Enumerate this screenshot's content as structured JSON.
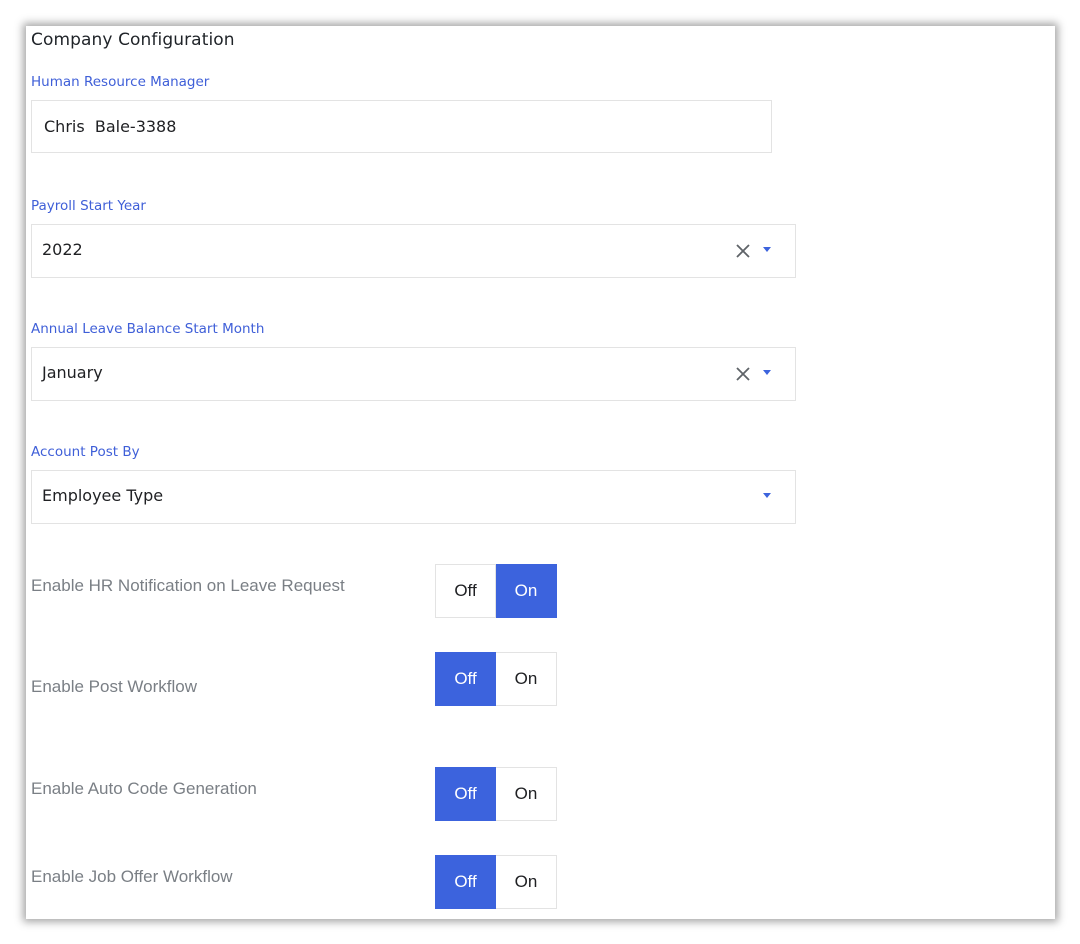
{
  "page": {
    "title": "Company Configuration"
  },
  "fields": {
    "hr_manager": {
      "label": "Human Resource Manager",
      "value": "Chris  Bale-3388"
    },
    "payroll_start_year": {
      "label": "Payroll Start Year",
      "value": "2022"
    },
    "leave_start_month": {
      "label": "Annual Leave Balance Start Month",
      "value": "January"
    },
    "account_post_by": {
      "label": "Account Post By",
      "value": "Employee Type"
    }
  },
  "toggles": [
    {
      "label": "Enable HR Notification on Leave Request",
      "off": "Off",
      "on": "On",
      "selected": "On"
    },
    {
      "label": "Enable Post Workflow",
      "off": "Off",
      "on": "On",
      "selected": "Off"
    },
    {
      "label": "Enable Auto Code Generation",
      "off": "Off",
      "on": "On",
      "selected": "Off"
    },
    {
      "label": "Enable Job Offer Workflow",
      "off": "Off",
      "on": "On",
      "selected": "Off"
    }
  ],
  "colors": {
    "accent": "#3c63dd",
    "label_blue": "#3f5fd8",
    "muted_text": "#7a7f85"
  },
  "icons": {
    "clear": "close-icon",
    "dropdown": "caret-down-icon"
  }
}
